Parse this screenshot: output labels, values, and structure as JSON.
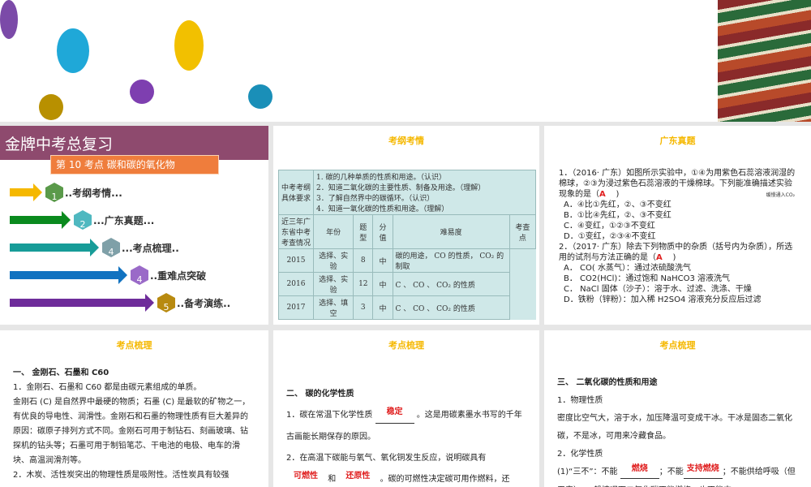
{
  "cover": {
    "title": "金牌中考总复习",
    "ribbon": "第 10 考点    碳和碳的氧化物",
    "items": [
      {
        "num": "1",
        "label": "..考纲考情...",
        "color": "#f5b800",
        "cube": "#5a9a4a"
      },
      {
        "num": "2",
        "label": "...广东真题...",
        "color": "#0a8a1e",
        "cube": "#4fb8c0"
      },
      {
        "num": "4",
        "label": "...考点梳理..",
        "color": "#179c98",
        "cube": "#7fa0a8"
      },
      {
        "num": "4",
        "label": "..重难点突破",
        "color": "#1172c0",
        "cube": "#9a6ac8"
      },
      {
        "num": "5",
        "label": "..备考演练..",
        "color": "#6e2c9a",
        "cube": "#b88a10"
      }
    ]
  },
  "outline": {
    "title": "考纲考情",
    "req_head": "中考考纲具体要求",
    "reqs": [
      "1. 碳的几种单质的性质和用途。（认识）",
      "2．知道二氧化碳的主要性质、制备及用途。（理解）",
      "3．了解自然界中的碳循环。（认识）",
      "4．知道一氧化碳的性质和用途。（理解）"
    ],
    "hist_head": "近三年广东省中考考查情况",
    "cols": [
      "年份",
      "题型",
      "分值",
      "难易度",
      "考查点"
    ],
    "rows": [
      [
        "2015",
        "选择、实验",
        "8",
        "中",
        "碳的用途， CO 的性质， CO₂ 的制取"
      ],
      [
        "2016",
        "选择、实验",
        "12",
        "中",
        "C 、 CO 、 CO₂ 的性质"
      ],
      [
        "2017",
        "选择、填空",
        "3",
        "中",
        "C 、 CO 、 CO₂ 的性质"
      ]
    ]
  },
  "exam": {
    "title": "广东真题",
    "q1": "1．（2016· 广东）如图所示实验中，①④为用紫色石蕊溶液润湿的棉球，②③为浸过紫色石蕊溶液的干燥棉球。下列能准确描述实验现象的是（",
    "q1_ans": "A",
    "q1_opts": [
      "A．④比①先红，②、③不变红",
      "B．①比④先红，②、③不变红",
      "C．④变红，①②③不变红",
      "D．①变红，②③④不变红"
    ],
    "q2": "2．（2017· 广东）除去下列物质中的杂质（括号内为杂质），所选用的试剂与方法正确的是（",
    "q2_ans": "A",
    "q2_opts": [
      "A． CO( 水蒸气）：通过浓硫酸洗气",
      "B． CO2(HCl)：通过饱和 NaHCO3 溶液洗气",
      "C． NaCl 固体（沙子）：溶于水、过滤、洗涤、干燥",
      "D．铁粉（锌粉）：加入稀 H2SO4 溶液充分反应后过滤"
    ],
    "fig_label": "缓慢通入CO₂",
    "close": ")"
  },
  "p4": {
    "title": "考点梳理",
    "h": "一、 金刚石、石墨和 C60",
    "body": [
      "1．金刚石、石墨和 C60 都是由碳元素组成的单质。",
      "金刚石 (C) 是自然界中最硬的物质；石墨 (C) 是最软的矿物之一，有优良的导电性、润滑性。金刚石和石墨的物理性质有巨大差异的原因：碳原子排列方式不同。金刚石可用于制钻石、刻画玻璃、钻探机的钻头等；石墨可用于制铅笔芯、干电池的电极、电车的滑块、高温润滑剂等。",
      "2．木炭、活性炭突出的物理性质是吸附性。活性炭具有较强"
    ]
  },
  "p5": {
    "title": "考点梳理",
    "h": "二、 碳的化学性质",
    "l1a": "1．碳在常温下化学性质",
    "a1": "稳定",
    "l1b": "。这是用碳素墨水书写的千年古画能长期保存的原因。",
    "l2": "2．在高温下碳能与氧气、氧化铜发生反应，说明碳具有",
    "a2": "可燃性",
    "and": "和",
    "a3": "还原性",
    "l2b": "。碳的可燃性决定碳可用作燃料，还"
  },
  "p6": {
    "title": "考点梳理",
    "h": "三、 二氧化碳的性质和用途",
    "s1": "1．物理性质",
    "b1": "密度比空气大，溶于水，加压降温可变成干冰。干冰是固态二氧化碳，不是冰，可用来冷藏食品。",
    "s2": "2．化学性质",
    "c1": "(1)“三不”：不能",
    "a1": "燃烧",
    "c2": "；不能",
    "a2": "支持燃烧",
    "c3": "；不能供给呼吸（但无毒），一般情况下二氧化碳不能燃烧，也不能支"
  }
}
